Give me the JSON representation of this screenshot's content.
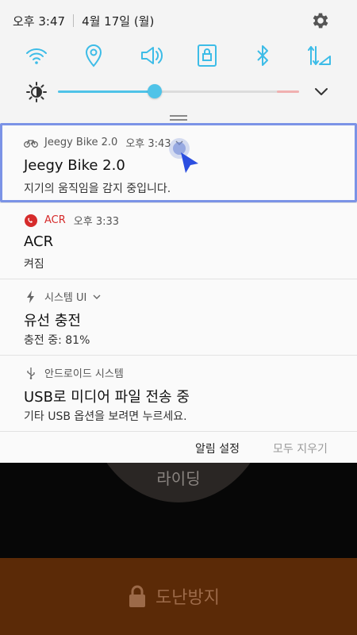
{
  "status_bar": {
    "time": "오후 3:47",
    "date": "4월 17일 (월)"
  },
  "quick_settings": {
    "tiles": [
      {
        "name": "wifi",
        "icon": "wifi-icon"
      },
      {
        "name": "location",
        "icon": "location-icon"
      },
      {
        "name": "sound",
        "icon": "sound-icon"
      },
      {
        "name": "screen-lock",
        "icon": "lock-rotation-icon"
      },
      {
        "name": "bluetooth",
        "icon": "bluetooth-icon"
      },
      {
        "name": "mobile-data",
        "icon": "mobile-data-icon"
      }
    ],
    "brightness": {
      "level": 0.4
    },
    "accent": "#4fc3e8"
  },
  "notifications": [
    {
      "app": "Jeegy Bike 2.0",
      "time": "오후 3:43",
      "title": "Jeegy Bike 2.0",
      "body": "지기의 움직임을 감지 중입니다.",
      "icon": "bicycle-icon"
    },
    {
      "app": "ACR",
      "time": "오후 3:33",
      "title": "ACR",
      "body": "켜짐",
      "icon": "phone-record-icon",
      "app_color": "#d62b2b"
    },
    {
      "app": "시스템 UI",
      "title": "유선 충전",
      "body": "충전 중: 81%",
      "icon": "lightning-icon"
    },
    {
      "app": "안드로이드 시스템",
      "title": "USB로 미디어 파일 전송 중",
      "body": "기타 USB 옵션을 보려면 누르세요.",
      "icon": "usb-icon"
    }
  ],
  "actions": {
    "settings": "알림 설정",
    "clear_all": "모두 지우기"
  },
  "background_app": {
    "ride_label": "라이딩",
    "theft_label": "도난방지",
    "theft_color": "#5b2a07"
  }
}
